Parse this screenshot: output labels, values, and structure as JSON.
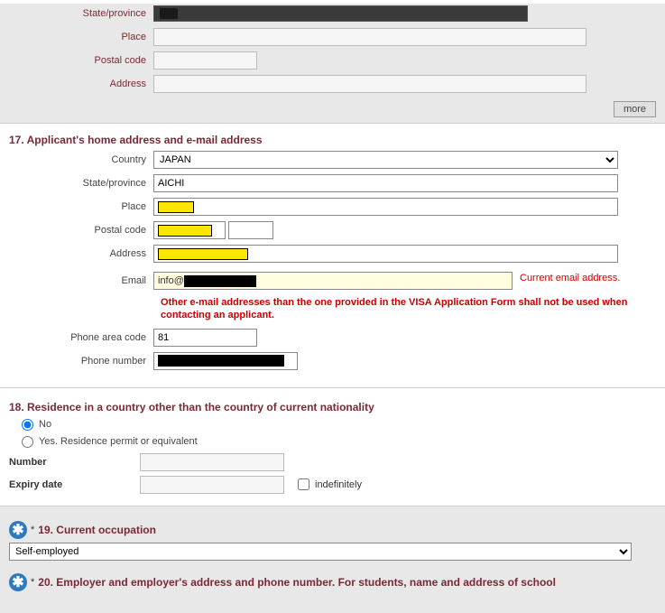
{
  "top_section": {
    "state_label": "State/province",
    "place_label": "Place",
    "postal_label": "Postal code",
    "address_label": "Address",
    "more_label": "more"
  },
  "sec17": {
    "heading": "17. Applicant's home address and e-mail address",
    "country_label": "Country",
    "country_value": "JAPAN",
    "state_label": "State/province",
    "state_value": "AICHI",
    "place_label": "Place",
    "postal_label": "Postal code",
    "address_label": "Address",
    "email_label": "Email",
    "email_prefix": "info@",
    "email_hint": "Current email address.",
    "email_note": "Other e-mail addresses than the one provided in the  VISA Application Form shall not be used when contacting  an applicant.",
    "area_code_label": "Phone area code",
    "area_code_value": "81",
    "phone_label": "Phone number"
  },
  "sec18": {
    "heading": "18. Residence in a country other than the country of current nationality",
    "no_label": "No",
    "yes_label": "Yes. Residence permit or equivalent",
    "number_label": "Number",
    "expiry_label": "Expiry date",
    "indef_label": "indefinitely"
  },
  "sec19": {
    "heading": "19. Current occupation",
    "value": "Self-employed"
  },
  "sec20": {
    "heading": "20. Employer and employer's address and phone number. For students, name and address of school"
  }
}
